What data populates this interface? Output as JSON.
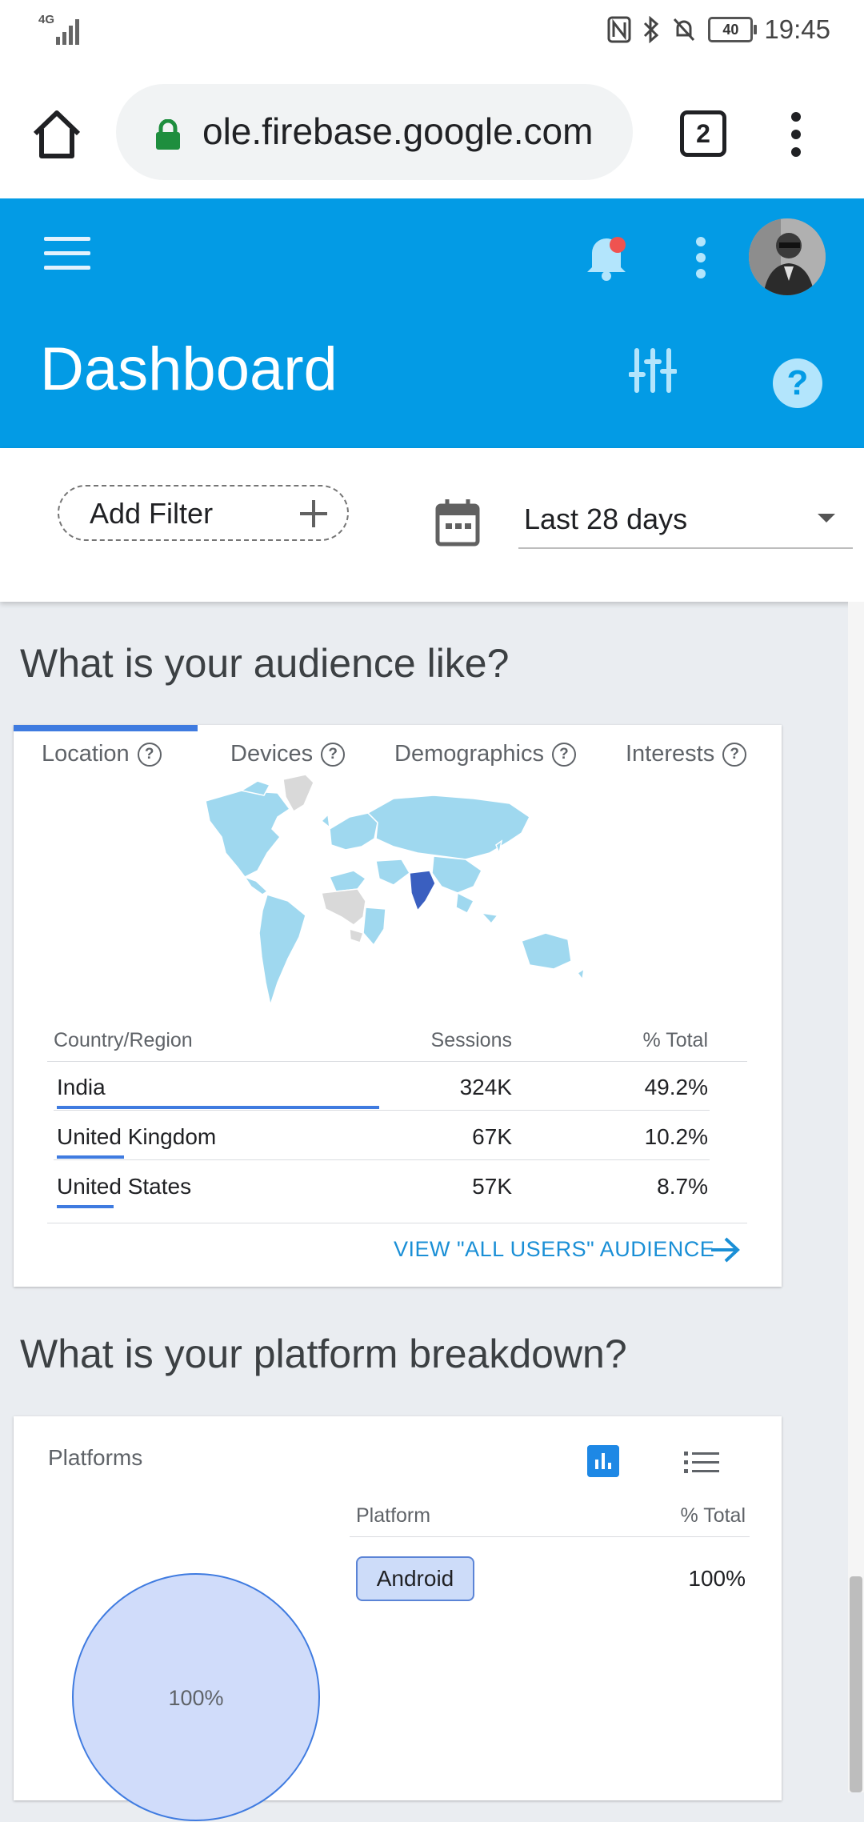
{
  "status_bar": {
    "network": "4G",
    "time": "19:45",
    "battery": "40"
  },
  "browser": {
    "url": "ole.firebase.google.com",
    "tab_count": "2"
  },
  "header": {
    "title": "Dashboard"
  },
  "filters": {
    "add_filter_label": "Add Filter",
    "date_range": "Last 28 days"
  },
  "audience": {
    "heading": "What is your audience like?",
    "tabs": [
      {
        "label": "Location",
        "active": true
      },
      {
        "label": "Devices",
        "active": false
      },
      {
        "label": "Demographics",
        "active": false
      },
      {
        "label": "Interests",
        "active": false
      }
    ],
    "table": {
      "columns": [
        "Country/Region",
        "Sessions",
        "% Total"
      ],
      "rows": [
        {
          "country": "India",
          "sessions": "324K",
          "pct": "49.2%",
          "share": 0.492
        },
        {
          "country": "United Kingdom",
          "sessions": "67K",
          "pct": "10.2%",
          "share": 0.102
        },
        {
          "country": "United States",
          "sessions": "57K",
          "pct": "8.7%",
          "share": 0.087
        }
      ]
    },
    "view_link": "VIEW \"ALL USERS\" AUDIENCE",
    "map_colors": {
      "active": "#9fd8ef",
      "highlight": "#3a5fc0",
      "inactive": "#d9d9d9"
    }
  },
  "platform": {
    "heading": "What is your platform breakdown?",
    "card_title": "Platforms",
    "columns": [
      "Platform",
      "% Total"
    ],
    "rows": [
      {
        "name": "Android",
        "pct": "100%"
      }
    ],
    "pie_label": "100%"
  },
  "colors": {
    "brand": "#039be5",
    "accent": "#3f7be0",
    "link": "#1a8fd6"
  }
}
